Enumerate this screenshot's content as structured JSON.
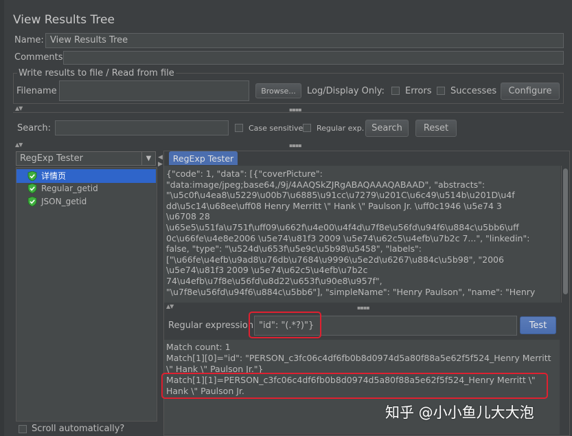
{
  "window": {
    "title": "View Results Tree"
  },
  "form": {
    "name_label": "Name:",
    "name_value": "View Results Tree",
    "comments_label": "Comments:"
  },
  "file_section": {
    "legend": "Write results to file / Read from file",
    "filename_label": "Filename",
    "filename_value": "",
    "browse_label": "Browse...",
    "log_display_label": "Log/Display Only:",
    "errors_label": "Errors",
    "successes_label": "Successes",
    "configure_label": "Configure"
  },
  "search": {
    "label": "Search:",
    "value": "",
    "case_sensitive_label": "Case sensitive",
    "regular_exp_label": "Regular exp.",
    "search_button": "Search",
    "reset_button": "Reset"
  },
  "renderer": {
    "selected": "RegExp Tester"
  },
  "tree": {
    "items": [
      {
        "label": "详情页",
        "selected": true
      },
      {
        "label": "Regular_getid",
        "selected": false
      },
      {
        "label": "JSON_getid",
        "selected": false
      }
    ],
    "scroll_auto_label": "Scroll automatically?"
  },
  "tab": {
    "label": "RegExp Tester"
  },
  "response": {
    "lines": [
      "{\"code\": 1, \"data\": [{\"coverPicture\":",
      "\"data:image/jpeg;base64,/9j/4AAQSkZJRgABAQAAAQABAAD\", \"abstracts\":",
      "\"\\u5c0f\\u4ea8\\u5229\\u00b7\\u6885\\u91cc\\u7279\\u201C\\u6c49\\u514b\\u201D\\u4f",
      "dd\\u5c14\\u68ee\\uff08 Henry Merritt \\\" Hank \\\" Paulson Jr. \\uff0c1946 \\u5e74 3",
      "\\u6708 28",
      "\\u65e5\\u51fa\\u751f\\uff09\\u662f\\u4e00\\u4f4d\\u7f8e\\u56fd\\u94f6\\u884c\\u5bb6\\uff",
      "0c\\u66fe\\u4e8e2006 \\u5e74\\u81f3 2009 \\u5e74\\u62c5\\u4efb\\u7b2c 7...\", \"linkedin\":",
      "false, \"type\": \"\\u524d\\u653f\\u5e9c\\u5b98\\u5458\", \"labels\":",
      "[\"\\u66fe\\u4efb\\u9ad8\\u76db\\u7684\\u9996\\u5e2d\\u6267\\u884c\\u5b98\", \"2006",
      "\\u5e74\\u81f3 2009 \\u5e74\\u62c5\\u4efb\\u7b2c",
      "74\\u4efb\\u7f8e\\u56fd\\u8d22\\u653f\\u90e8\\u957f\",",
      "\"\\u7f8e\\u56fd\\u94f6\\u884c\\u5bb6\"], \"simpleName\": \"Henry Paulson\", \"name\": \"Henry"
    ]
  },
  "regex": {
    "label": "Regular expression:",
    "value": "\"id\": \"(.*?)\"}",
    "test_button": "Test"
  },
  "results": {
    "match_count": "Match count: 1",
    "m0_line1": "Match[1][0]=\"id\": \"PERSON_c3fc06c4df6fb0b8d0974d5a80f88a5e62f5f524_Henry Merritt",
    "m0_line2": "\\\" Hank \\\" Paulson Jr.\"}",
    "m1_line1": "Match[1][1]=PERSON_c3fc06c4df6fb0b8d0974d5a80f88a5e62f5f524_Henry Merritt \\\"",
    "m1_line2": "Hank \\\" Paulson Jr."
  },
  "watermark": "知乎 @小小鱼儿大大泡",
  "colors": {
    "background": "#3c3f41",
    "field": "#45494a",
    "highlight_box": "#e02030",
    "selection": "#2f65ca"
  }
}
